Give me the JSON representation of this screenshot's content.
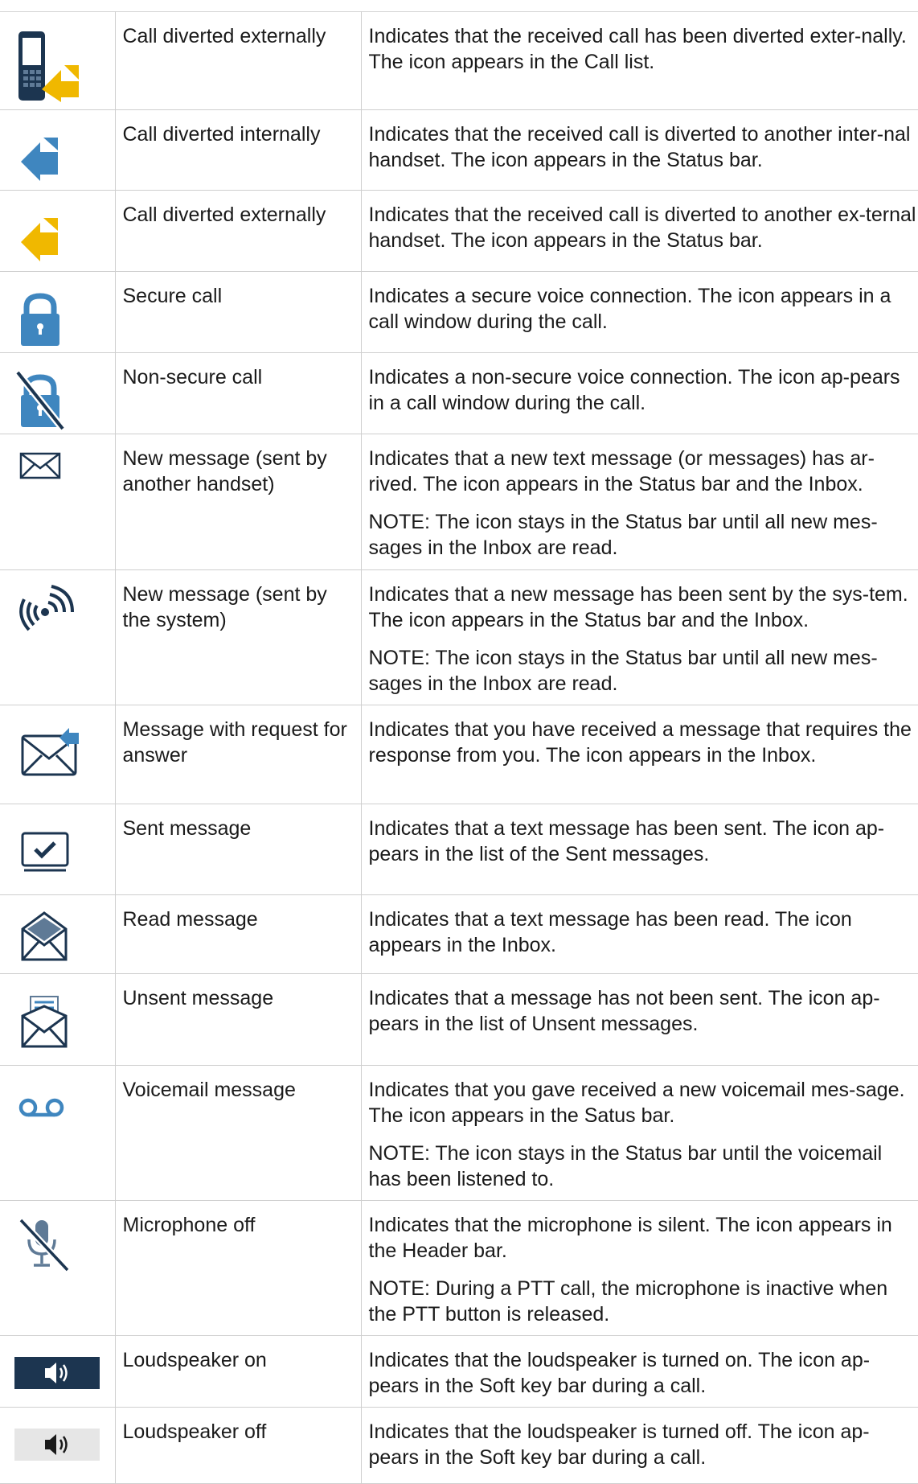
{
  "rows": [
    {
      "icon": "phone-divert-external-icon",
      "name": "Call diverted externally",
      "desc": "Indicates that the received call has been diverted exter-nally. The icon appears in the Call list."
    },
    {
      "icon": "divert-internal-arrow-icon",
      "name": "Call diverted internally",
      "desc": "Indicates that the received call is diverted to another inter-nal handset. The icon appears in the Status bar."
    },
    {
      "icon": "divert-external-arrow-icon",
      "name": "Call diverted externally",
      "desc": "Indicates that the received call is diverted to another ex-ternal handset. The icon appears in the Status bar."
    },
    {
      "icon": "padlock-icon",
      "name": "Secure call",
      "desc": "Indicates a secure voice connection. The icon appears in a call window during the call."
    },
    {
      "icon": "padlock-crossed-icon",
      "name": "Non-secure call",
      "desc": "Indicates a non-secure voice connection. The icon ap-pears in a call window during the call."
    },
    {
      "icon": "envelope-icon",
      "name": "New message (sent by another handset)",
      "desc": "Indicates that a new text message (or messages) has ar-rived. The icon appears in the Status bar and the Inbox.",
      "note": "NOTE: The icon stays in the Status bar until all new mes-sages in the Inbox are read."
    },
    {
      "icon": "broadcast-icon",
      "name": "New message (sent by the system)",
      "desc": "Indicates that a new message has been sent by the sys-tem. The icon appears in the Status bar and the Inbox.",
      "note": "NOTE: The icon stays in the Status bar until all new mes-sages in the Inbox are read."
    },
    {
      "icon": "envelope-reply-icon",
      "name": "Message with request for answer",
      "desc": "Indicates that you have received a message that requires the response from you. The icon appears in the Inbox."
    },
    {
      "icon": "sent-check-icon",
      "name": "Sent message",
      "desc": "Indicates that a text message has been sent. The icon ap-pears in the list of the Sent messages."
    },
    {
      "icon": "envelope-open-icon",
      "name": "Read message",
      "desc": "Indicates that a text message has been read. The icon appears in the Inbox."
    },
    {
      "icon": "envelope-unsent-icon",
      "name": "Unsent message",
      "desc": "Indicates that a message has not been sent. The icon ap-pears in the list of Unsent messages."
    },
    {
      "icon": "voicemail-icon",
      "name": "Voicemail message",
      "desc": "Indicates that you gave received a new voicemail mes-sage. The icon appears in the Satus bar.",
      "note": "NOTE: The icon stays in the Status bar until the voicemail has been listened to."
    },
    {
      "icon": "microphone-off-icon",
      "name": "Microphone off",
      "desc": "Indicates that the microphone is silent. The icon appears in the Header bar.",
      "note": "NOTE: During a PTT call, the microphone is inactive when the PTT button is released."
    },
    {
      "icon": "loudspeaker-on-icon",
      "name": "Loudspeaker on",
      "desc": "Indicates that the loudspeaker is turned on. The icon ap-pears in the Soft key bar during a call."
    },
    {
      "icon": "loudspeaker-off-icon",
      "name": "Loudspeaker off",
      "desc": "Indicates that the loudspeaker is turned off. The icon ap-pears in the Soft key bar during a call."
    }
  ]
}
